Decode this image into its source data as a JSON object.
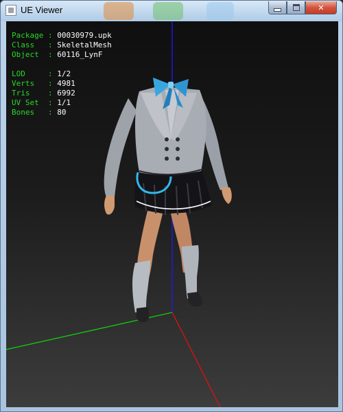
{
  "window": {
    "title": "UE Viewer",
    "controls": {
      "minimize": "minimize",
      "maximize": "maximize",
      "close": "close"
    }
  },
  "info": {
    "group1": [
      {
        "label": "Package",
        "value": "00030979.upk"
      },
      {
        "label": "Class",
        "value": "SkeletalMesh"
      },
      {
        "label": "Object",
        "value": "60116_LynF"
      }
    ],
    "group2": [
      {
        "label": "LOD",
        "value": "1/2"
      },
      {
        "label": "Verts",
        "value": "4981"
      },
      {
        "label": "Tris",
        "value": "6992"
      },
      {
        "label": "UV Set",
        "value": "1/1"
      },
      {
        "label": "Bones",
        "value": "80"
      }
    ]
  },
  "colors": {
    "label": "#28d828",
    "value": "#ffffff",
    "axis_x": "#e01010",
    "axis_y": "#10d010",
    "axis_z": "#1a1aff",
    "jacket": "#a8adb4",
    "skirt": "#141418",
    "bow": "#3aa6e0",
    "skin": "#d09a72"
  }
}
